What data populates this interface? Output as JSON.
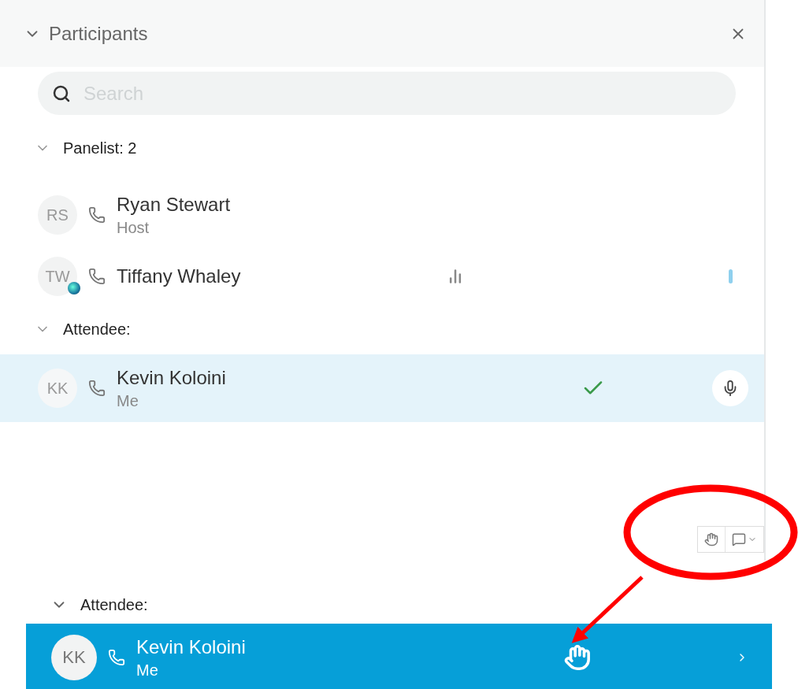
{
  "panel": {
    "title": "Participants",
    "expanded": true
  },
  "search": {
    "placeholder": "Search"
  },
  "groups": [
    {
      "label": "Panelist: 2",
      "expanded": true,
      "rows": [
        {
          "initials": "RS",
          "name": "Ryan Stewart",
          "role": "Host",
          "presenter": false,
          "audio_bars": false,
          "checked": false,
          "mic_level": false,
          "mic_button": false,
          "selected": false
        },
        {
          "initials": "TW",
          "name": "Tiffany Whaley",
          "presenter": true,
          "audio_bars": true,
          "checked": false,
          "mic_level": true,
          "mic_button": false,
          "selected": false
        }
      ]
    },
    {
      "label": "Attendee:",
      "expanded": true,
      "rows": [
        {
          "initials": "KK",
          "name": "Kevin Koloini",
          "role": "Me",
          "presenter": false,
          "audio_bars": false,
          "checked": true,
          "mic_level": false,
          "mic_button": true,
          "selected": true
        }
      ]
    }
  ],
  "zoomed": {
    "label": "Attendee:",
    "expanded": true,
    "row": {
      "initials": "KK",
      "name": "Kevin Koloini",
      "role": "Me",
      "hand_raised": true,
      "selected": true
    }
  }
}
